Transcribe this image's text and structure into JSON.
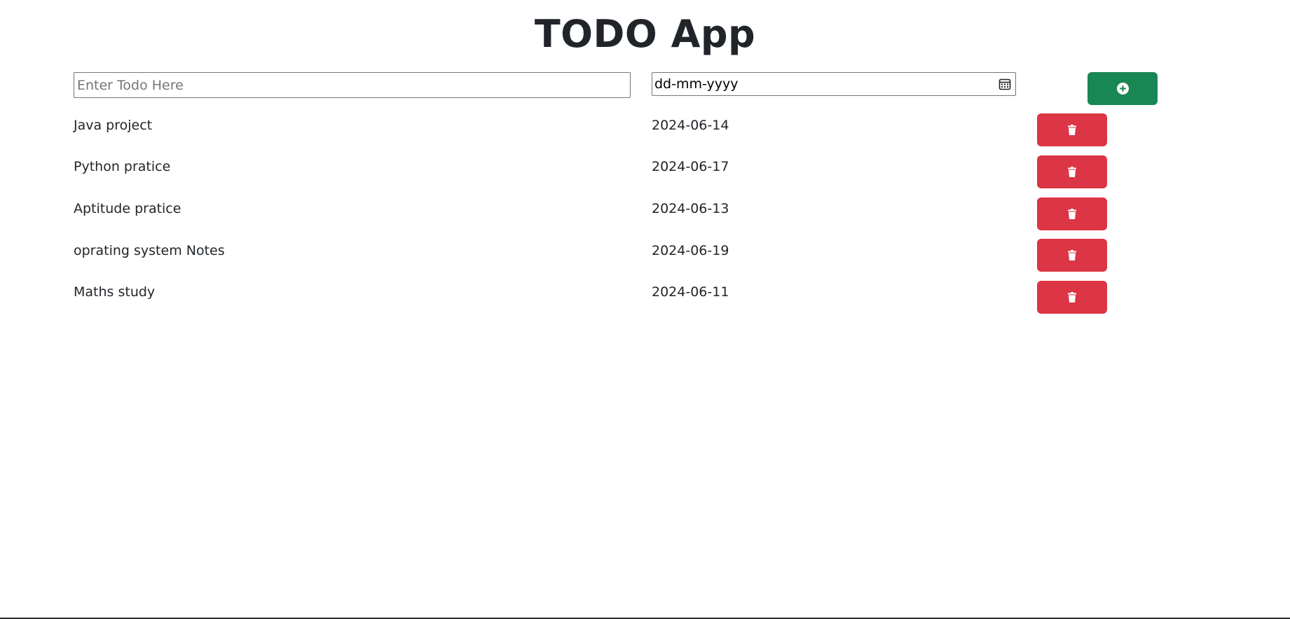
{
  "header": {
    "title": "TODO App"
  },
  "form": {
    "todo_placeholder": "Enter Todo Here",
    "todo_value": "",
    "date_placeholder": "dd-mm-yyyy",
    "add_button_icon": "plus-circle-icon"
  },
  "colors": {
    "add_button": "#198754",
    "delete_button": "#dc3545",
    "text": "#212529"
  },
  "todos": [
    {
      "name": "Java project",
      "date": "2024-06-14",
      "delete_icon": "trash-icon"
    },
    {
      "name": "Python pratice",
      "date": "2024-06-17",
      "delete_icon": "trash-icon"
    },
    {
      "name": "Aptitude pratice",
      "date": "2024-06-13",
      "delete_icon": "trash-icon"
    },
    {
      "name": "oprating system Notes",
      "date": "2024-06-19",
      "delete_icon": "trash-icon"
    },
    {
      "name": "Maths study",
      "date": "2024-06-11",
      "delete_icon": "trash-icon"
    }
  ]
}
